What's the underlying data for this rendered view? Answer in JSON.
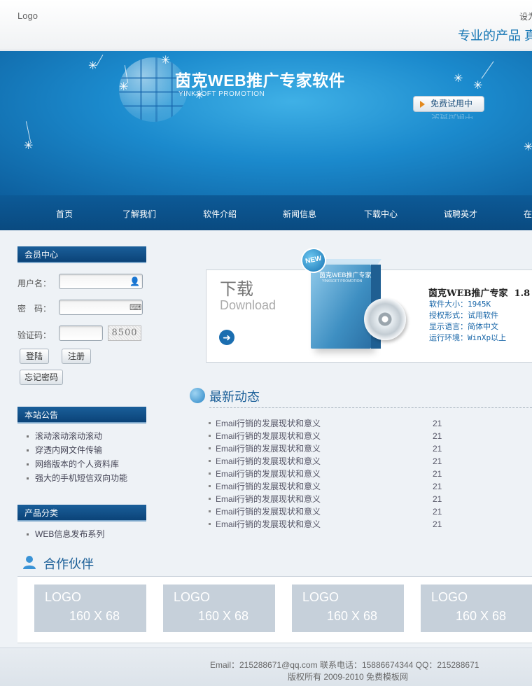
{
  "header": {
    "logo": "Logo",
    "top_link": "设为",
    "slogan": "专业的产品 真"
  },
  "banner": {
    "title": "茵克WEB推广专家软件",
    "subtitle": "YINKSOFT PROMOTION",
    "trial_button": "免费试用中",
    "trial_reflection": "免费试用中"
  },
  "nav": {
    "items": [
      "首页",
      "了解我们",
      "软件介绍",
      "新闻信息",
      "下载中心",
      "诚聘英才",
      "在"
    ]
  },
  "member": {
    "heading": "会员中心",
    "username_label": "用户名：",
    "password_label": "密　码：",
    "captcha_label": "验证码：",
    "captcha_code": "8500",
    "login_button": "登陆",
    "register_button": "注册",
    "forgot_button": "忘记密码"
  },
  "notice": {
    "heading": "本站公告",
    "items": [
      "滚动滚动滚动滚动",
      "穿透内网文件传输",
      "网络版本的个人资料库",
      "强大的手机短信双向功能"
    ]
  },
  "category": {
    "heading": "产品分类",
    "items": [
      "WEB信息发布系列"
    ]
  },
  "download": {
    "title": "下载",
    "subtitle": "Download",
    "badge": "NEW",
    "box_label": "茵克WEB推广专家",
    "box_sub": "YINKSOFT PROMOTION",
    "product_name": "茵克WEB推广专家  1.8",
    "info": [
      "软件大小：1945K",
      "授权形式：试用软件",
      "显示语言：简体中文",
      "运行环境：WinXp以上"
    ]
  },
  "news": {
    "title": "最新动态",
    "items": [
      {
        "title": "Email行销的发展现状和意义",
        "date": "21"
      },
      {
        "title": "Email行销的发展现状和意义",
        "date": "21"
      },
      {
        "title": "Email行销的发展现状和意义",
        "date": "21"
      },
      {
        "title": "Email行销的发展现状和意义",
        "date": "21"
      },
      {
        "title": "Email行销的发展现状和意义",
        "date": "21"
      },
      {
        "title": "Email行销的发展现状和意义",
        "date": "21"
      },
      {
        "title": "Email行销的发展现状和意义",
        "date": "21"
      },
      {
        "title": "Email行销的发展现状和意义",
        "date": "21"
      },
      {
        "title": "Email行销的发展现状和意义",
        "date": "21"
      }
    ]
  },
  "partners": {
    "title": "合作伙伴",
    "logos": [
      {
        "line1": "LOGO",
        "line2": "160 X 68"
      },
      {
        "line1": "LOGO",
        "line2": "160 X 68"
      },
      {
        "line1": "LOGO",
        "line2": "160 X 68"
      },
      {
        "line1": "LOGO",
        "line2": "160 X 68"
      }
    ]
  },
  "footer": {
    "line1": "Email：215288671@qq.com 联系电话：15886674344 QQ：215288671",
    "line2": "版权所有 2009-2010 免费模板网"
  },
  "colors": {
    "banner_blue": "#1b8acd",
    "nav_blue": "#0c5a97",
    "heading_blue": "#1b5f98",
    "accent_orange": "#e38a1f"
  }
}
